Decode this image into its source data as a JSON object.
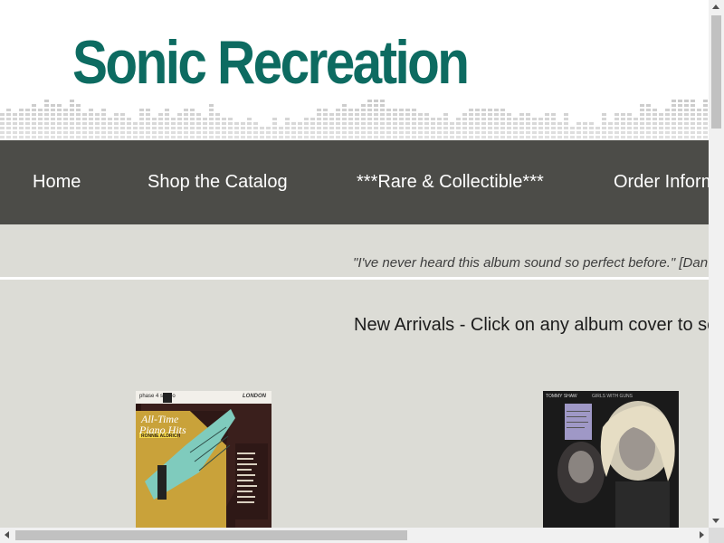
{
  "site": {
    "title": "Sonic Recreation"
  },
  "nav": {
    "items": [
      {
        "label": "Home"
      },
      {
        "label": "Shop the Catalog"
      },
      {
        "label": "***Rare & Collectible***"
      },
      {
        "label": "Order Information"
      }
    ]
  },
  "quote": {
    "text": "\"I've never heard this album sound so perfect before.\" [Dan R."
  },
  "new_arrivals": {
    "heading": "New Arrivals - Click on any album cover to see"
  },
  "albums": [
    {
      "badge": "phase 4 stereo",
      "label": "LONDON",
      "title_line1": "All-Time",
      "title_line2": "Piano Hits",
      "artist": "RONNIE ALDRICH"
    },
    {
      "artist": "TOMMY SHAW",
      "title": "GIRLS WITH GUNS"
    }
  ],
  "colors": {
    "brand": "#0d6b61",
    "nav_bg": "#4c4c48",
    "page_bg": "#dcdcd6",
    "eq_bars": "#c8c8c8"
  }
}
